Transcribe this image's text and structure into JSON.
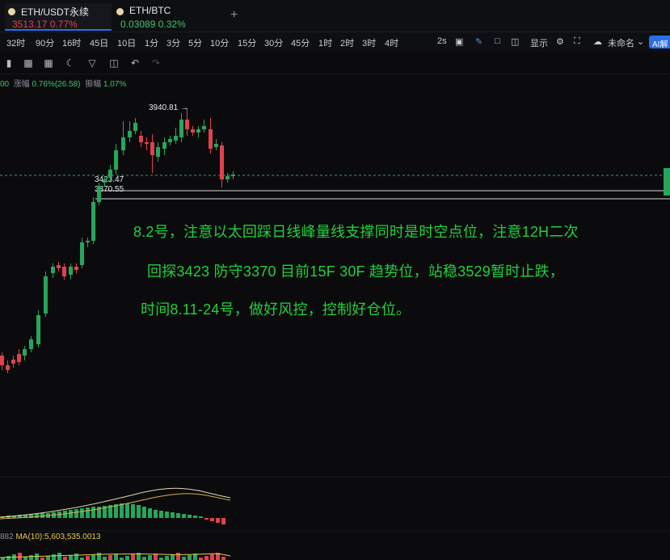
{
  "tabs": [
    {
      "name": "ETH/USDT永续",
      "price": "3513.17",
      "change": "0.77%",
      "active": true
    },
    {
      "name": "ETH/BTC",
      "price": "0.03089",
      "change": "0.32%",
      "active": false
    }
  ],
  "new_tab": "+",
  "intervals": [
    "32时",
    "90分",
    "16时",
    "45日",
    "10日",
    "1分",
    "3分",
    "5分",
    "10分",
    "15分",
    "30分",
    "45分",
    "1时",
    "2时",
    "3时",
    "4时"
  ],
  "toolbar_right": {
    "countdown": "2s",
    "display": "显示",
    "layout_name": "未命名",
    "ai": "AI解"
  },
  "info_line": {
    "prefix": "00",
    "change_label": "涨幅",
    "change": "0.76%(26.58)",
    "amp_label": "振幅",
    "amp": "1.07%"
  },
  "price_labels": {
    "high": "3940.81",
    "level1": "3423.47",
    "level2": "3370.55"
  },
  "annotation": [
    "8.2号，注意以太回踩日线峰量线支撑同时是时空点位，注意12H二次",
    "回探3423   防守3370  目前15F  30F 趋势位，站稳3529暂时止跌，",
    "时间8.11-24号，做好风控，控制好仓位。"
  ],
  "ma_line": {
    "prefix": "882",
    "label": "MA(10):",
    "value": "5,603,535.0013"
  },
  "colors": {
    "up": "#26a65b",
    "down": "#e0424c",
    "note": "#1fd13a",
    "accent": "#2b6de8"
  }
}
